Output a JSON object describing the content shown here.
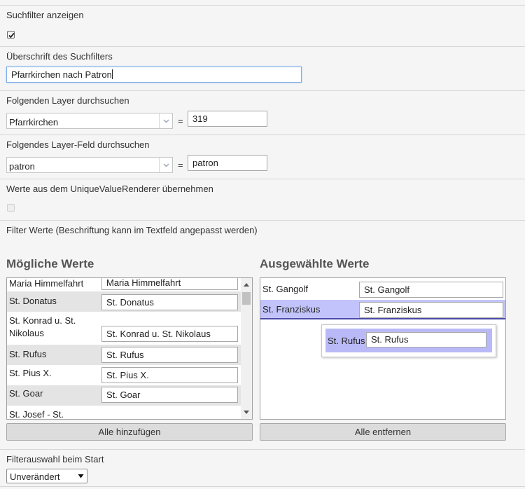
{
  "section_show_filter": {
    "label": "Suchfilter anzeigen",
    "checked": true
  },
  "section_heading": {
    "label": "Überschrift des Suchfilters",
    "value": "Pfarrkirchen nach Patron"
  },
  "section_layer": {
    "label": "Folgenden Layer durchsuchen",
    "selected": "Pfarrkirchen",
    "equals": "=",
    "id_value": "319"
  },
  "section_field": {
    "label": "Folgendes Layer-Feld durchsuchen",
    "selected": "patron",
    "equals": "=",
    "field_value": "patron"
  },
  "section_renderer": {
    "label": "Werte aus dem UniqueValueRenderer übernehmen",
    "checked": false
  },
  "section_values": {
    "label": "Filter Werte (Beschriftung kann im Textfeld angepasst werden)"
  },
  "possible": {
    "title": "Mögliche Werte",
    "rows": [
      {
        "name": "Maria Himmelfahrt",
        "value": "Maria Himmelfahrt"
      },
      {
        "name": "St. Donatus",
        "value": "St. Donatus"
      },
      {
        "name": "St. Konrad u. St. Nikolaus",
        "value": "St. Konrad u. St. Nikolaus"
      },
      {
        "name": "St. Rufus",
        "value": "St. Rufus"
      },
      {
        "name": "St. Pius X.",
        "value": "St. Pius X."
      },
      {
        "name": "St. Goar",
        "value": "St. Goar"
      },
      {
        "name": "St. Josef - St.",
        "value": ""
      }
    ],
    "add_all_label": "Alle hinzufügen"
  },
  "selected": {
    "title": "Ausgewählte Werte",
    "rows": [
      {
        "name": "St. Gangolf",
        "value": "St. Gangolf"
      },
      {
        "name": "St. Franziskus",
        "value": "St. Franziskus"
      }
    ],
    "dragging": {
      "name": "St. Rufus",
      "value": "St. Rufus"
    },
    "remove_all_label": "Alle entfernen"
  },
  "section_start": {
    "label": "Filterauswahl beim Start",
    "selected": "Unverändert"
  },
  "colors": {
    "highlight": "#c3c3fb",
    "drag_bg": "#b9b9f7",
    "accent_focus": "#7eaee8"
  }
}
